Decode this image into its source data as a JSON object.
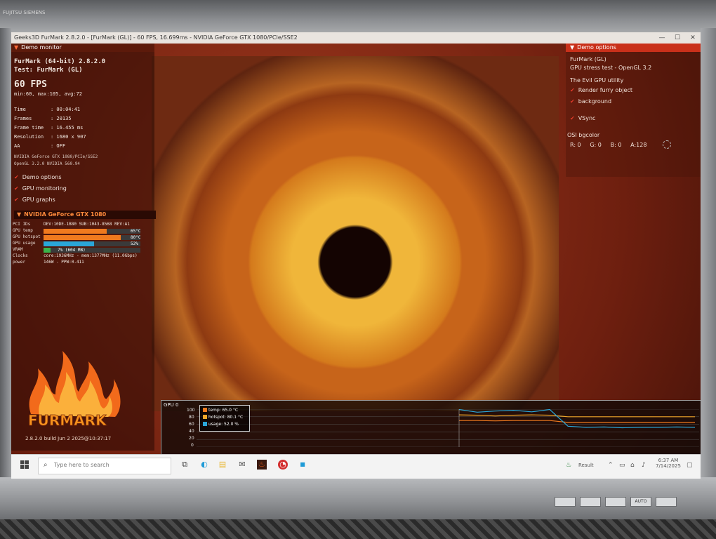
{
  "bezel": {
    "brand": "FUJITSU SIEMENS",
    "buttons": [
      "",
      "",
      "",
      "AUTO",
      ""
    ]
  },
  "window": {
    "title": "Geeks3D FurMark 2.8.2.0 - [FurMark (GL)] - 60 FPS, 16.699ms - NVIDIA GeForce GTX 1080/PCIe/SSE2",
    "controls": {
      "minimize": "—",
      "maximize": "☐",
      "close": "✕"
    }
  },
  "demo_monitor": {
    "header": "Demo monitor",
    "title_line1": "FurMark (64-bit) 2.8.2.0",
    "title_line2": "Test: FurMark (GL)",
    "fps": "60 FPS",
    "fps_stats": "min:60, max:105, avg:72",
    "rows": [
      {
        "key": "Time",
        "value": ": 00:04:41"
      },
      {
        "key": "Frames",
        "value": ": 20135"
      },
      {
        "key": "Frame time",
        "value": ": 16.455 ms"
      },
      {
        "key": "Resolution",
        "value": ": 1680 x 907"
      },
      {
        "key": "AA",
        "value": ": OFF"
      }
    ],
    "gpu_line1": "NVIDIA GeForce GTX 1080/PCIe/SSE2",
    "gpu_line2": "OpenGL 3.2.0 NVIDIA 560.94",
    "options": [
      "Demo options",
      "GPU monitoring",
      "GPU graphs"
    ]
  },
  "gpu_panel": {
    "header": "NVIDIA GeForce GTX 1080",
    "rows": [
      {
        "label": "PCI IDs",
        "text": "DEV:10DE-1B80 SUB:1043-8568 REV:A1",
        "bar": null,
        "color": "",
        "value": ""
      },
      {
        "label": "GPU temp",
        "text": "",
        "bar": 0.65,
        "color": "#f07a1e",
        "value": "65°C"
      },
      {
        "label": "GPU hotspot",
        "text": "",
        "bar": 0.8,
        "color": "#f07a1e",
        "value": "80°C"
      },
      {
        "label": "GPU usage",
        "text": "",
        "bar": 0.52,
        "color": "#2aa6d8",
        "value": "52%"
      },
      {
        "label": "VRAM",
        "text": "",
        "bar": 0.07,
        "color": "#39b54a",
        "value": "7% (604 MB)"
      },
      {
        "label": "Clocks",
        "text": "core:1936MHz - mem:1377MHz (11.0Gbps)",
        "bar": null,
        "color": "",
        "value": ""
      },
      {
        "label": "power",
        "text": "146W - PPW:0.411",
        "bar": null,
        "color": "",
        "value": ""
      }
    ]
  },
  "logo": {
    "text": "FURMARK",
    "build": "2.8.2.0 build Jun  2 2025@10:37:17"
  },
  "demo_options": {
    "header": "Demo options",
    "line1": "FurMark (GL)",
    "line2": "GPU stress test - OpenGL 3.2",
    "line3": "The Evil GPU utility",
    "checks": [
      "Render furry object",
      "background",
      "VSync"
    ],
    "osi_label": "OSI bgcolor",
    "osi_values": "R: 0     G: 0     B: 0     A:128"
  },
  "graph": {
    "title": "GPU 0",
    "y_ticks": [
      "100",
      "80",
      "60",
      "40",
      "20",
      "0"
    ],
    "legend": [
      {
        "label": "temp: 65.0 °C",
        "color": "#f07a1e"
      },
      {
        "label": "hotspot: 80.1 °C",
        "color": "#f0a62a"
      },
      {
        "label": "usage: 52.0 %",
        "color": "#2aa6d8"
      }
    ]
  },
  "chart_data": {
    "type": "line",
    "title": "GPU 0",
    "xlabel": "",
    "ylabel": "",
    "ylim": [
      0,
      100
    ],
    "x": [
      0,
      1,
      2,
      3,
      4,
      5,
      6,
      7,
      8,
      9,
      10,
      11,
      12,
      13
    ],
    "series": [
      {
        "name": "temp",
        "values": [
          70,
          70,
          69,
          70,
          70,
          70,
          65,
          65,
          65,
          65,
          65,
          65,
          65,
          65
        ]
      },
      {
        "name": "hotspot",
        "values": [
          85,
          84,
          82,
          84,
          85,
          84,
          80,
          80,
          80,
          80,
          80,
          80,
          80,
          80
        ]
      },
      {
        "name": "usage",
        "values": [
          99,
          92,
          95,
          97,
          93,
          99,
          55,
          52,
          53,
          51,
          52,
          52,
          53,
          52
        ]
      }
    ]
  },
  "taskbar": {
    "search_placeholder": "Type here to search",
    "tray_label": "Result",
    "time": "6:37 AM",
    "date": "7/14/2025"
  }
}
